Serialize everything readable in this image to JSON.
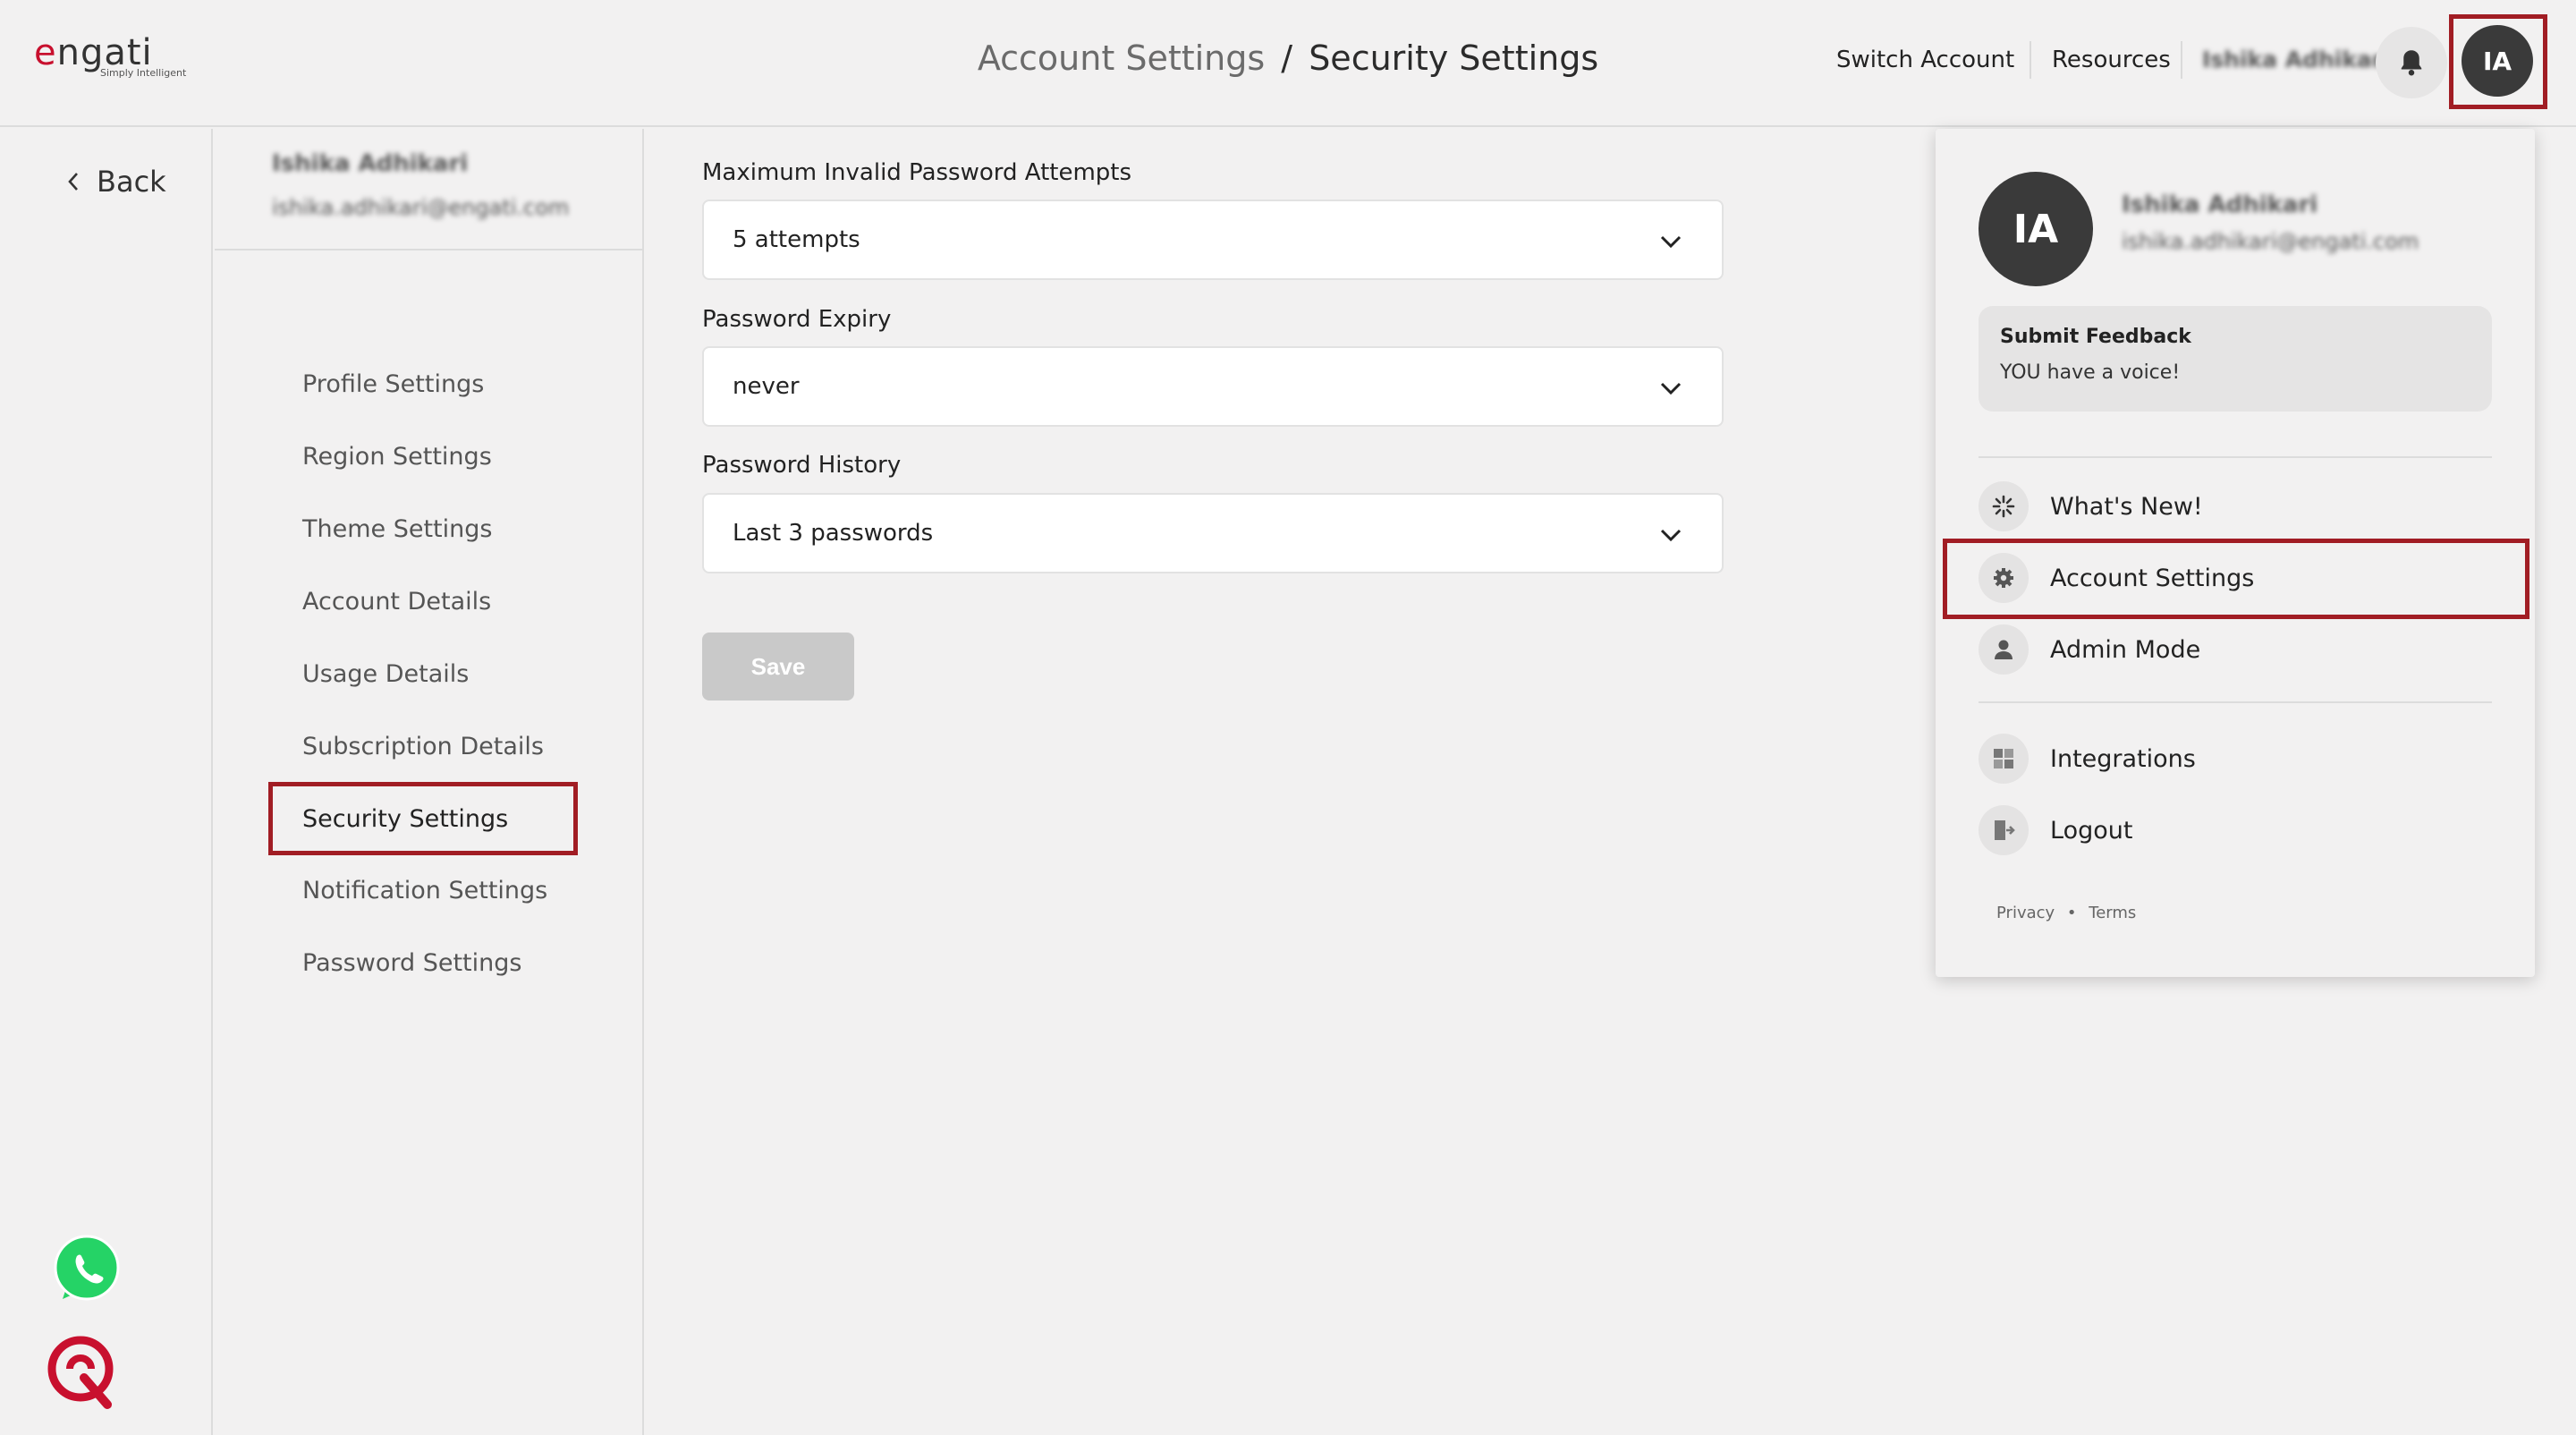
{
  "header": {
    "logo_text": "engati",
    "logo_tagline": "Simply Intelligent",
    "breadcrumb_parent": "Account Settings",
    "breadcrumb_separator": "/",
    "breadcrumb_current": "Security Settings",
    "switch_account": "Switch Account",
    "resources": "Resources",
    "user_name": "Ishika Adhikari",
    "avatar_initials": "IA"
  },
  "left_rail": {
    "back_label": "Back"
  },
  "settings_nav": {
    "user_name": "Ishika Adhikari",
    "user_email": "ishika.adhikari@engati.com",
    "items": [
      {
        "label": "Profile Settings"
      },
      {
        "label": "Region Settings"
      },
      {
        "label": "Theme Settings"
      },
      {
        "label": "Account Details"
      },
      {
        "label": "Usage Details"
      },
      {
        "label": "Subscription Details"
      },
      {
        "label": "Security Settings"
      },
      {
        "label": "Notification Settings"
      },
      {
        "label": "Password Settings"
      }
    ],
    "active_item": "Security Settings"
  },
  "form": {
    "max_attempts": {
      "label": "Maximum Invalid Password Attempts",
      "value": "5 attempts"
    },
    "password_expiry": {
      "label": "Password Expiry",
      "value": "never"
    },
    "password_history": {
      "label": "Password History",
      "value": "Last 3 passwords"
    },
    "save_label": "Save"
  },
  "profile_menu": {
    "avatar_initials": "IA",
    "user_name": "Ishika Adhikari",
    "user_email": "ishika.adhikari@engati.com",
    "feedback_title": "Submit Feedback",
    "feedback_subtitle": "YOU have a voice!",
    "items": [
      {
        "label": "What's New!",
        "icon": "sparkle-icon"
      },
      {
        "label": "Account Settings",
        "icon": "gear-icon"
      },
      {
        "label": "Admin Mode",
        "icon": "person-icon"
      },
      {
        "label": "Integrations",
        "icon": "integrations-icon"
      },
      {
        "label": "Logout",
        "icon": "logout-icon"
      }
    ],
    "footer_privacy": "Privacy",
    "footer_dot": "•",
    "footer_terms": "Terms"
  },
  "colors": {
    "highlight": "#a11d24",
    "brand_red": "#c8102e",
    "whatsapp_green": "#25d366"
  }
}
